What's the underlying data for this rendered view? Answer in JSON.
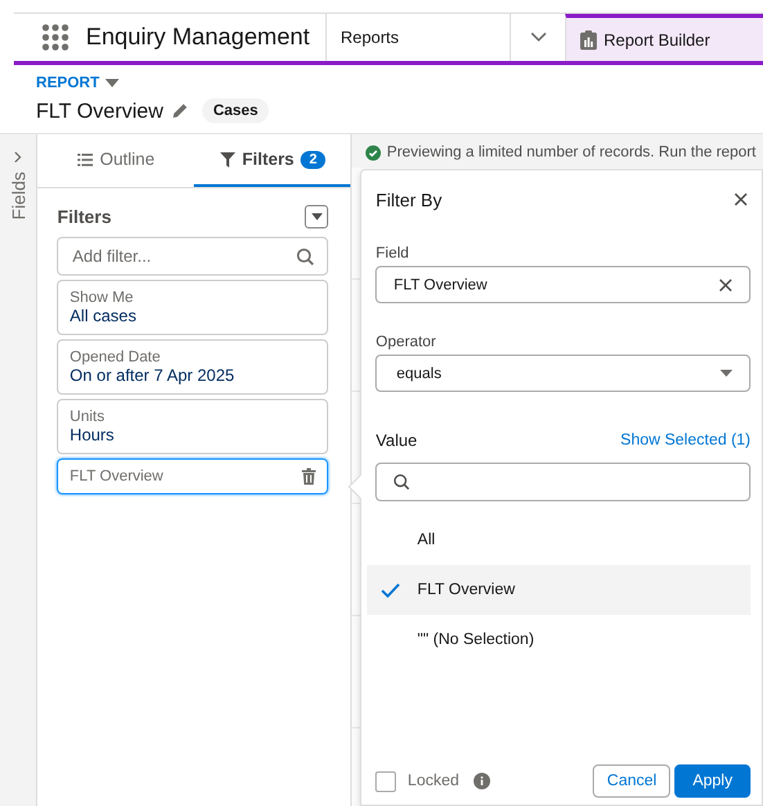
{
  "nav": {
    "app_name": "Enquiry Management",
    "tabs": [
      {
        "label": "Reports",
        "selected": false
      },
      {
        "label": "Report Builder",
        "selected": true
      }
    ]
  },
  "header": {
    "type_label": "REPORT",
    "title": "FLT Overview",
    "badge": "Cases"
  },
  "fields_panel": {
    "label": "Fields"
  },
  "side_tabs": [
    {
      "label": "Outline",
      "selected": false
    },
    {
      "label": "Filters",
      "count": "2",
      "selected": true
    }
  ],
  "filters": {
    "heading": "Filters",
    "search_placeholder": "Add filter...",
    "items": [
      {
        "label": "Show Me",
        "value": "All cases",
        "active": false
      },
      {
        "label": "Opened Date",
        "value": "On or after 7 Apr 2025",
        "active": false
      },
      {
        "label": "Units",
        "value": "Hours",
        "active": false
      },
      {
        "label": "FLT Overview",
        "active": true
      }
    ]
  },
  "banner": "Previewing a limited number of records. Run the report",
  "popover": {
    "title": "Filter By",
    "field_label": "Field",
    "field_value": "FLT Overview",
    "operator_label": "Operator",
    "operator_value": "equals",
    "value_label": "Value",
    "show_selected": "Show Selected (1)",
    "options": [
      {
        "label": "All",
        "selected": false
      },
      {
        "label": "FLT Overview",
        "selected": true
      },
      {
        "label": "\"\" (No Selection)",
        "selected": false
      }
    ],
    "locked_label": "Locked",
    "locked": false,
    "buttons": [
      "Cancel",
      "Apply"
    ]
  }
}
